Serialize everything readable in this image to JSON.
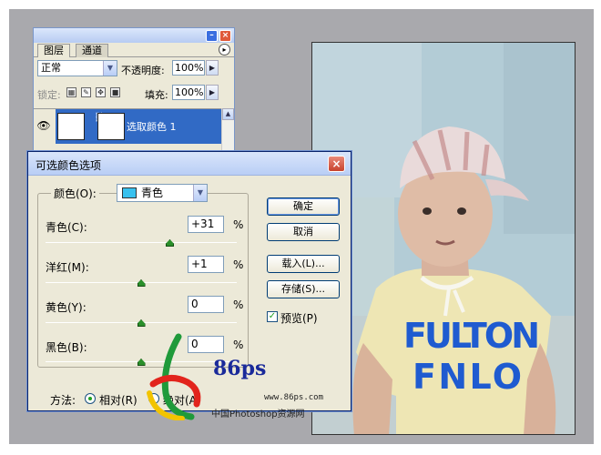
{
  "layers_panel": {
    "tabs": [
      "图层",
      "通道"
    ],
    "blend_mode": "正常",
    "opacity_label": "不透明度:",
    "opacity_value": "100%",
    "lock_label": "锁定:",
    "fill_label": "填充:",
    "fill_value": "100%",
    "layer_name": "选取颜色 1"
  },
  "dialog": {
    "title": "可选颜色选项",
    "colors_label": "颜色(O):",
    "colors_value": "青色",
    "sliders": [
      {
        "label": "青色(C):",
        "value": "+31",
        "percent": "%",
        "position": 0.65
      },
      {
        "label": "洋红(M):",
        "value": "+1",
        "percent": "%",
        "position": 0.5
      },
      {
        "label": "黄色(Y):",
        "value": "0",
        "percent": "%",
        "position": 0.5
      },
      {
        "label": "黑色(B):",
        "value": "0",
        "percent": "%",
        "position": 0.5
      }
    ],
    "buttons": {
      "ok": "确定",
      "cancel": "取消",
      "load": "载入(L)...",
      "save": "存储(S)..."
    },
    "preview_label": "预览(P)",
    "method_label": "方法:",
    "method_relative": "相对(R)",
    "method_absolute": "绝对(A)"
  },
  "watermark": {
    "brand": "86ps",
    "url": "www.86ps.com",
    "caption": "中国Photoshop资源网"
  },
  "photo": {
    "shirt_text_line1": "FULTON",
    "shirt_text_line2": "FNLO"
  }
}
